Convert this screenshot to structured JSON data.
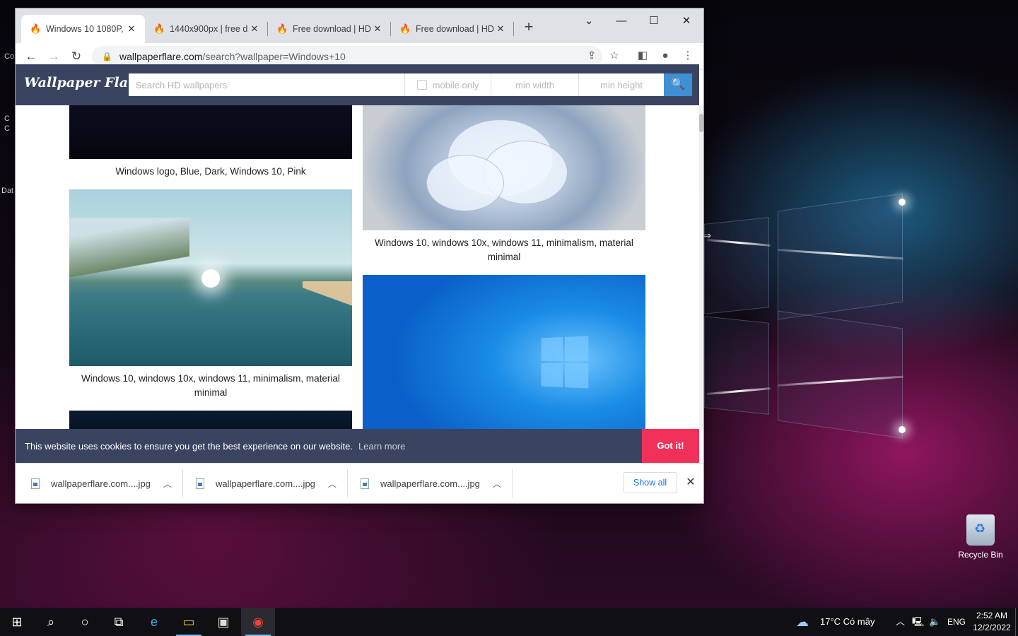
{
  "browser": {
    "tabs": [
      {
        "label": "Windows 10 1080P,",
        "active": true
      },
      {
        "label": "1440x900px | free d",
        "active": false
      },
      {
        "label": "Free download | HD",
        "active": false
      },
      {
        "label": "Free download | HD",
        "active": false
      }
    ],
    "new_tab_label": "+",
    "window_controls": {
      "tab_search": "⌄",
      "minimize": "—",
      "maximize": "☐",
      "close": "✕"
    },
    "url": {
      "host": "wallpaperflare.com",
      "path": "/search?wallpaper=Windows+10"
    }
  },
  "site": {
    "logo": "Wallpaper Flare",
    "search_placeholder": "Search HD wallpapers",
    "mobile_only_label": "mobile only",
    "min_width_label": "min width",
    "min_height_label": "min height"
  },
  "results": {
    "left": [
      {
        "caption": "Windows logo, Blue, Dark, Windows 10, Pink"
      },
      {
        "caption": "Windows 10, windows 10x, windows 11, minimalism, material minimal"
      }
    ],
    "right": [
      {
        "caption": "Windows 10, windows 10x, windows 11, minimalism, material minimal"
      }
    ]
  },
  "cookie": {
    "message": "This website uses cookies to ensure you get the best experience on our website.",
    "learn_more": "Learn more",
    "accept": "Got it!"
  },
  "downloads": {
    "items": [
      {
        "filename": "wallpaperflare.com....jpg"
      },
      {
        "filename": "wallpaperflare.com....jpg"
      },
      {
        "filename": "wallpaperflare.com....jpg"
      }
    ],
    "show_all": "Show all"
  },
  "desktop": {
    "recycle_bin": "Recycle Bin",
    "left_sliver_labels": [
      "Co",
      "C",
      "C",
      "Dat"
    ]
  },
  "taskbar": {
    "weather": "17°C  Có mây",
    "language": "ENG",
    "time": "2:52 AM",
    "date": "12/2/2022"
  },
  "colors": {
    "site_header": "#3a4460",
    "search_button": "#3f8fd6",
    "cookie_accept": "#f1315a",
    "link_blue": "#1a73e8"
  }
}
